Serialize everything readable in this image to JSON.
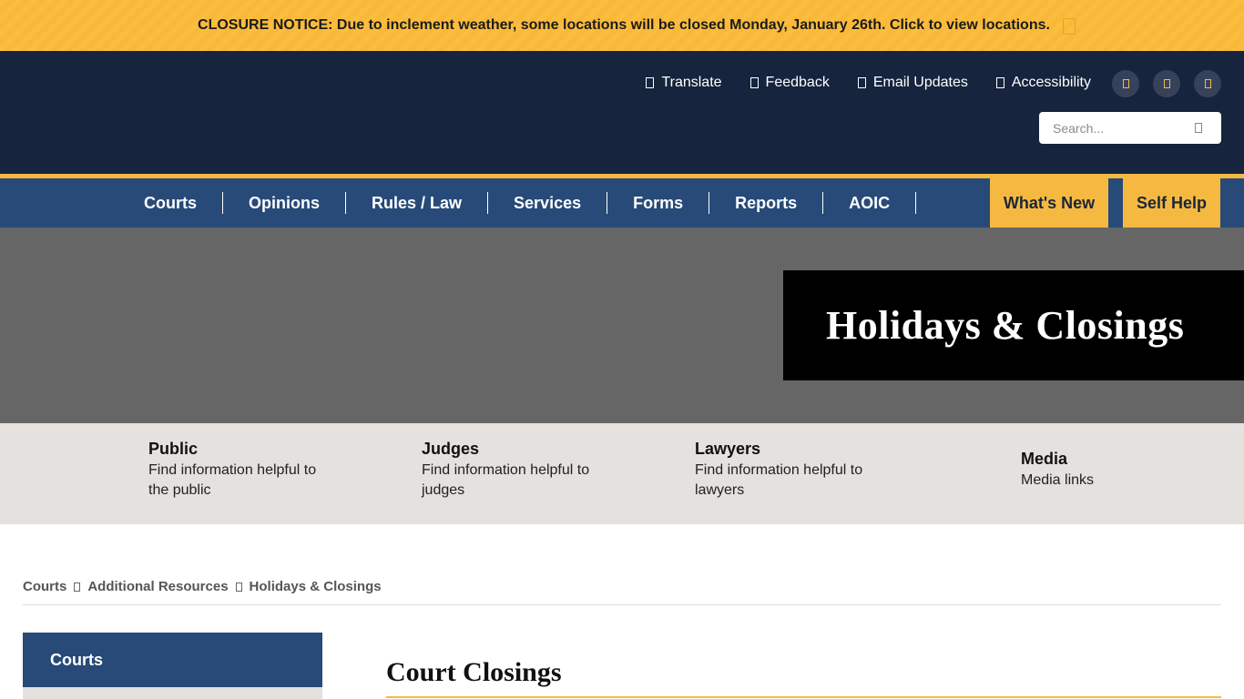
{
  "closure_banner": {
    "text": "CLOSURE NOTICE: Due to inclement weather, some locations will be closed Monday, January 26th. Click to view locations.",
    "dismiss_icon": "close-icon",
    "background": "#fbbd3f"
  },
  "header": {
    "utility_links": [
      {
        "label": "Translate",
        "icon": "globe-icon"
      },
      {
        "label": "Feedback",
        "icon": "comment-icon"
      },
      {
        "label": "Email Updates",
        "icon": "envelope-icon"
      },
      {
        "label": "Accessibility",
        "icon": "accessibility-icon"
      }
    ],
    "social": [
      "facebook-icon",
      "twitter-icon",
      "youtube-icon"
    ],
    "search": {
      "placeholder": "Search..."
    },
    "background": "#16243d"
  },
  "nav": {
    "items": [
      "Courts",
      "Opinions",
      "Rules / Law",
      "Services",
      "Forms",
      "Reports",
      "AOIC"
    ],
    "cta": [
      "What's New",
      "Self Help"
    ],
    "background": "#274a78",
    "accent": "#f5b942"
  },
  "hero": {
    "title": "Holidays & Closings"
  },
  "audience": [
    {
      "title": "Public",
      "desc": "Find information helpful to the public"
    },
    {
      "title": "Judges",
      "desc": "Find information helpful to judges"
    },
    {
      "title": "Lawyers",
      "desc": "Find information helpful to lawyers"
    },
    {
      "title": "Media",
      "desc": "Media links"
    }
  ],
  "breadcrumb": [
    "Courts",
    "Additional Resources",
    "Holidays & Closings"
  ],
  "sidebar": {
    "heading": "Courts"
  },
  "main": {
    "heading": "Court Closings"
  }
}
